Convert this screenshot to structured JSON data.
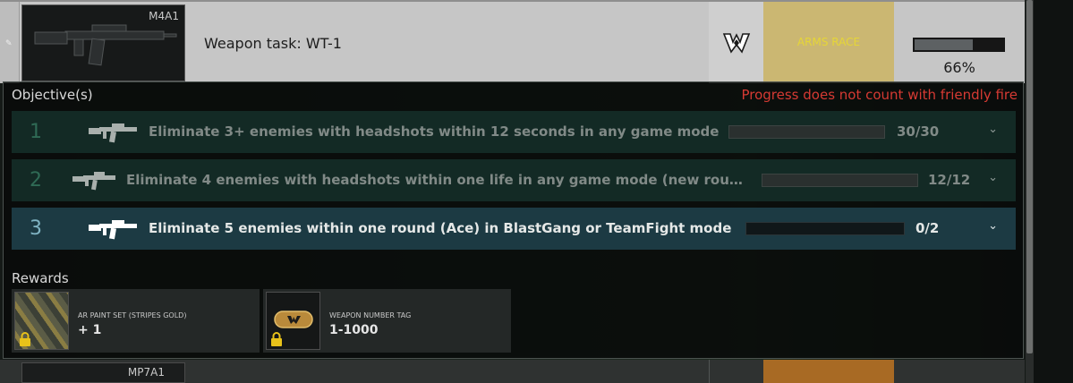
{
  "task": {
    "weapon_model": "M4A1",
    "title": "Weapon task: WT-1",
    "category": "ARMS RACE",
    "progress_value": 0.66,
    "progress_label": "66%",
    "drag_glyph": "✎"
  },
  "panel": {
    "objectives_heading": "Objective(s)",
    "friendly_fire_warning": "Progress does not count with friendly fire",
    "objectives": [
      {
        "number": "1",
        "text": "Eliminate 3+ enemies with headshots within 12 seconds in any game mode",
        "current": 30,
        "total": 30,
        "count_label": "30/30",
        "status": "completed"
      },
      {
        "number": "2",
        "text": "Eliminate 4 enemies with headshots within one life in any game mode (new rou…",
        "current": 12,
        "total": 12,
        "count_label": "12/12",
        "status": "completed"
      },
      {
        "number": "3",
        "text": "Eliminate 5 enemies within one round (Ace) in BlastGang or TeamFight mode",
        "current": 0,
        "total": 2,
        "count_label": "0/2",
        "status": "active"
      }
    ],
    "chevron": "⌄",
    "rewards_heading": "Rewards",
    "rewards": [
      {
        "name": "AR PAINT SET (STRIPES GOLD)",
        "value": "+ 1",
        "icon": "paint-swatch-icon",
        "locked": true
      },
      {
        "name": "WEAPON NUMBER TAG",
        "value": "1-1000",
        "icon": "number-tag-icon",
        "locked": true
      }
    ]
  },
  "next_task": {
    "weapon_model": "MP7A1"
  },
  "colors": {
    "accent_gold": "#e6d636",
    "arms_race_bg": "#cbb772",
    "warning_red": "#d63a33",
    "completed_row": "#132a25",
    "active_row": "#1c3a43"
  }
}
